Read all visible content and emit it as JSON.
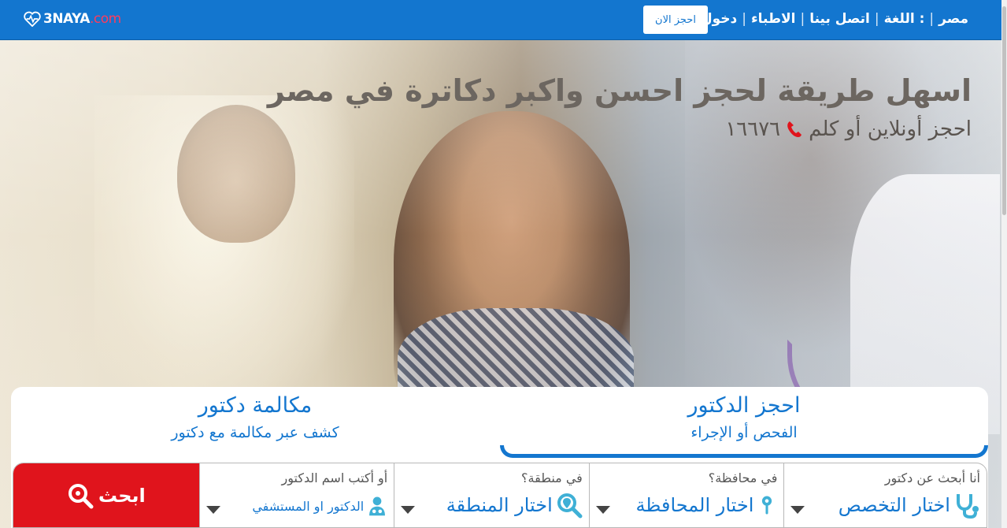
{
  "nav": {
    "logo": {
      "text": "3NAYA",
      "suffix": ".com"
    },
    "book_now": "احجز الان",
    "links": [
      "مصر",
      "اللغة :",
      "اتصل بينا",
      "الاطباء",
      "دخول"
    ]
  },
  "hero": {
    "title": "اسهل طريقة لحجز احسن واكبر دكاترة في مصر",
    "subtitle": "احجز أونلاين أو كلم",
    "phone": "١٦٦٧٦"
  },
  "tabs": {
    "book_doctor": {
      "title": "احجز الدكتور",
      "subtitle": "الفحص أو الإجراء"
    },
    "call_doctor": {
      "title": "مكالمة دكتور",
      "subtitle": "كشف عبر مكالمة مع دكتور"
    }
  },
  "search": {
    "specialty": {
      "label": "أنا أبحث عن دكتور",
      "value": "اختار التخصص"
    },
    "governorate": {
      "label": "في محافظة؟",
      "value": "اختار المحافظة"
    },
    "area": {
      "label": "في منطقة؟",
      "value": "اختار المنطقة"
    },
    "name": {
      "label": "أو أكتب اسم الدكتور",
      "value": "الدكتور او المستشفي"
    },
    "button": "ابحث"
  },
  "colors": {
    "brand": "#1376cf",
    "search_button": "#e0141c",
    "logo_dot": "#ff3b5c"
  }
}
